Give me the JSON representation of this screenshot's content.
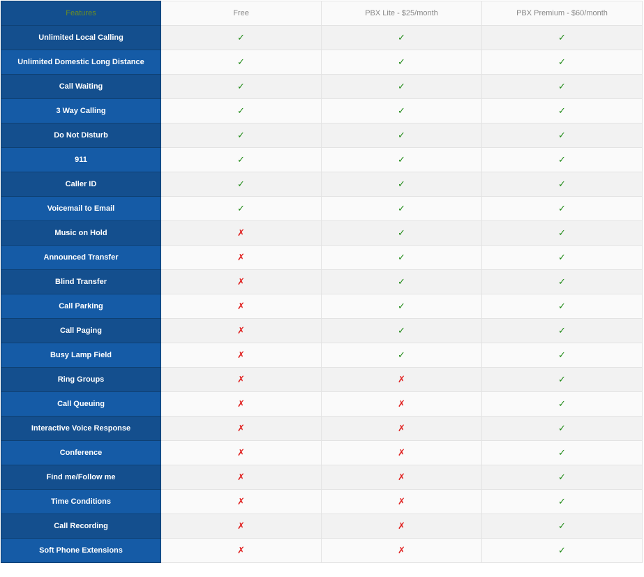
{
  "table": {
    "headers": {
      "feature": "Features",
      "plans": [
        "Free",
        "PBX Lite - $25/month",
        "PBX Premium - $60/month"
      ]
    },
    "marks": {
      "yes": "✓",
      "no": "✗"
    },
    "colors": {
      "feature_header_text": "#6b8e23",
      "feature_dark": "#144f8e",
      "feature_light": "#155ba6",
      "check": "#1f8a16",
      "cross": "#e0201f"
    },
    "rows": [
      {
        "feature": "Unlimited Local Calling",
        "values": [
          true,
          true,
          true
        ]
      },
      {
        "feature": "Unlimited Domestic Long Distance",
        "values": [
          true,
          true,
          true
        ]
      },
      {
        "feature": "Call Waiting",
        "values": [
          true,
          true,
          true
        ]
      },
      {
        "feature": "3 Way Calling",
        "values": [
          true,
          true,
          true
        ]
      },
      {
        "feature": "Do Not Disturb",
        "values": [
          true,
          true,
          true
        ]
      },
      {
        "feature": "911",
        "values": [
          true,
          true,
          true
        ]
      },
      {
        "feature": "Caller ID",
        "values": [
          true,
          true,
          true
        ]
      },
      {
        "feature": "Voicemail to Email",
        "values": [
          true,
          true,
          true
        ]
      },
      {
        "feature": "Music on Hold",
        "values": [
          false,
          true,
          true
        ]
      },
      {
        "feature": "Announced Transfer",
        "values": [
          false,
          true,
          true
        ]
      },
      {
        "feature": "Blind Transfer",
        "values": [
          false,
          true,
          true
        ]
      },
      {
        "feature": "Call Parking",
        "values": [
          false,
          true,
          true
        ]
      },
      {
        "feature": "Call Paging",
        "values": [
          false,
          true,
          true
        ]
      },
      {
        "feature": "Busy Lamp Field",
        "values": [
          false,
          true,
          true
        ]
      },
      {
        "feature": "Ring Groups",
        "values": [
          false,
          false,
          true
        ]
      },
      {
        "feature": "Call Queuing",
        "values": [
          false,
          false,
          true
        ]
      },
      {
        "feature": "Interactive Voice Response",
        "values": [
          false,
          false,
          true
        ]
      },
      {
        "feature": "Conference",
        "values": [
          false,
          false,
          true
        ]
      },
      {
        "feature": "Find me/Follow me",
        "values": [
          false,
          false,
          true
        ]
      },
      {
        "feature": "Time Conditions",
        "values": [
          false,
          false,
          true
        ]
      },
      {
        "feature": "Call Recording",
        "values": [
          false,
          false,
          true
        ]
      },
      {
        "feature": "Soft Phone Extensions",
        "values": [
          false,
          false,
          true
        ]
      }
    ]
  }
}
